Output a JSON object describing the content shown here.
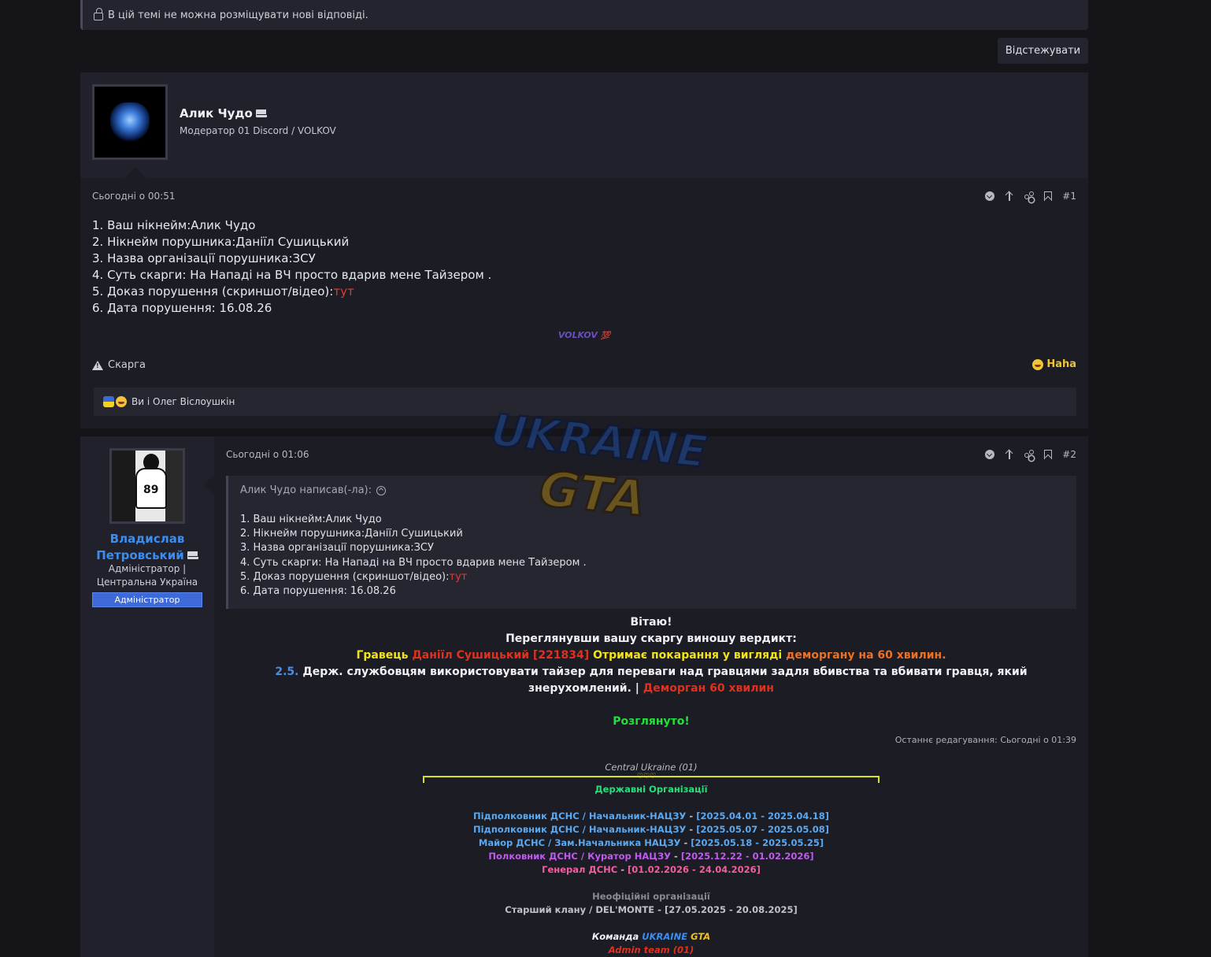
{
  "notice": {
    "text": "В цій темі не можна розміщувати нові відповіді."
  },
  "follow_label": "Відстежувати",
  "post1": {
    "author": "Алик Чудо",
    "title": "Модератор 01 Discord / VOLKOV",
    "date": "Сьогодні о 00:51",
    "number": "#1",
    "lines": [
      "1. Ваш нікнейм:Алик Чудо",
      "2. Нікнейм порушника:Даніїл Сушицький",
      "3. Назва організації порушника:ЗСУ",
      "4. Суть скарги: На Нападі на ВЧ просто вдарив мене Тайзером .",
      "5. Доказ порушення (скриншот/відео):",
      "6. Дата порушення: 16.08.26"
    ],
    "link_text": "тут",
    "signature": "VOLKOV",
    "signature_emoji": "💯",
    "report_label": "Скарга",
    "reaction_label": "Haha",
    "reactions_text": "Ви і Олег Віслоушкін"
  },
  "post2": {
    "author_line1": "Владислав",
    "author_line2": "Петровський",
    "title_line1": "Адміністратор |",
    "title_line2": "Центральна Україна",
    "badge": "Адміністратор",
    "date": "Сьогодні о 01:06",
    "number": "#2",
    "quote_header": "Алик Чудо написав(-ла):",
    "quote_lines": [
      "1. Ваш нікнейм:Алик Чудо",
      "2. Нікнейм порушника:Даніїл Сушицький",
      "3. Назва організації порушника:ЗСУ",
      "4. Суть скарги: На Нападі на ВЧ просто вдарив мене Тайзером .",
      "5. Доказ порушення (скриншот/відео):",
      "6. Дата порушення: 16.08.26"
    ],
    "quote_link": "тут",
    "greeting": "Вітаю!",
    "verdict_intro": "Переглянувши вашу скаргу виношу вердикт:",
    "player_prefix": "Гравець",
    "player_name": "Даніїл Сушицький [221834]",
    "punish_text": "Отримає покарання у вигляді",
    "punish_value": "деморгану на 60 хвилин.",
    "rule_num": "2.5.",
    "rule_text": "Держ. службовцям використовувати тайзер для переваги над гравцями задля вбивства та вбивати гравця, який знерухомлений. |",
    "rule_punish": "Деморган 60 хвилин",
    "status": "Розглянуто!",
    "edited": "Останнє редагування: Сьогодні о 01:39"
  },
  "signature2": {
    "server": "Central Ukraine (01)",
    "hearts": "♡♡♡",
    "org_header": "Державні Організації",
    "ranks": [
      {
        "role": "Підполковник ДСНС / Начальник-НАЦЗУ",
        "period": "[2025.04.01 - 2025.04.18]",
        "color": "#5aa8f0"
      },
      {
        "role": "Підполковник ДСНС / Начальник-НАЦЗУ",
        "period": "[2025.05.07 - 2025.05.08]",
        "color": "#5aa8f0"
      },
      {
        "role": "Майор ДСНС / Зам.Начальника НАЦЗУ",
        "period": "[2025.05.18 - 2025.05.25]",
        "color": "#5aa8f0"
      },
      {
        "role": "Полковник ДСНС / Куратор НАЦЗУ",
        "period": "[2025.12.22 - 01.02.2026]",
        "color": "#c05af0"
      },
      {
        "role": "Генерал ДСНС",
        "period": "[01.02.2026 - 24.04.2026]",
        "color": "#f060a0"
      }
    ],
    "unofficial_header": "Неофіційні організації",
    "unofficial_role": "Старший клану / DEL'MONTE",
    "unofficial_period": "[27.05.2025 - 20.08.2025]",
    "team_label": "Команда",
    "team_ukraine": "UKRAINE",
    "team_gta": "GTA",
    "admin_team": "Admin team (01)"
  },
  "watermark": {
    "line1": "UKRAINE",
    "line2": "GTA"
  },
  "colors": {
    "background": "#141419",
    "panel": "#1c1c25",
    "accent_blue": "#3b8ef0",
    "red": "#e53b2c",
    "yellow": "#f2e21e",
    "green": "#23e03a"
  }
}
